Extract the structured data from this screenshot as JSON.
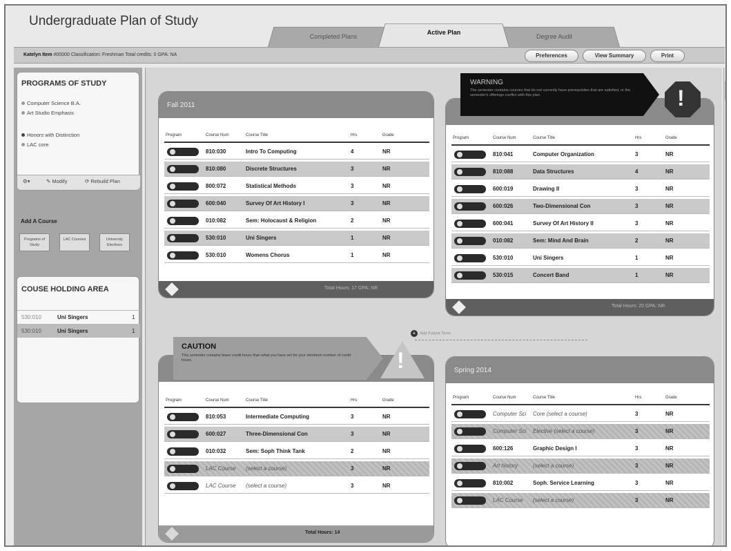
{
  "app_title": "Undergraduate Plan of Study",
  "tabs": [
    {
      "label": "Completed Plans"
    },
    {
      "label": "Active Plan",
      "active": true
    },
    {
      "label": "Degree Audit"
    }
  ],
  "student": {
    "name": "Katelyn Item",
    "id": "#00000",
    "info": "Classification: Freshman   Total credits: 0   GPA: NA"
  },
  "header_buttons": [
    "Preferences",
    "View Summary",
    "Print"
  ],
  "sidebar": {
    "programs_title": "PROGRAMS OF STUDY",
    "programs": [
      "Computer Science B.A.",
      "Art Studio Emphasis",
      "Honors with Distinction",
      "LAC core"
    ],
    "actions": {
      "modify": "Modify",
      "rebuild": "Rebuild Plan"
    },
    "add_course": {
      "title": "Add A Course",
      "buttons": [
        "Programs of Study",
        "LAC Courses",
        "University Electives"
      ]
    },
    "holding": {
      "title": "COUSE HOLDING AREA",
      "items": [
        {
          "num": "530:010",
          "title": "Uni Singers",
          "hrs": "1"
        },
        {
          "num": "530:010",
          "title": "Uni Singers",
          "hrs": "1"
        }
      ]
    }
  },
  "columns": [
    "Program",
    "Course Num",
    "Course Title",
    "Hrs",
    "Grade"
  ],
  "semesters": {
    "fall2011": {
      "title": "Fall 2011",
      "rows": [
        {
          "num": "810:030",
          "title": "Intro To Computing",
          "hrs": "4",
          "grade": "NR"
        },
        {
          "num": "810:080",
          "title": "Discrete Structures",
          "hrs": "3",
          "grade": "NR"
        },
        {
          "num": "800:072",
          "title": "Statistical Methods",
          "hrs": "3",
          "grade": "NR"
        },
        {
          "num": "600:040",
          "title": "Survey Of Art History I",
          "hrs": "3",
          "grade": "NR"
        },
        {
          "num": "010:082",
          "title": "Sem: Holocaust & Religion",
          "hrs": "2",
          "grade": "NR"
        },
        {
          "num": "530:010",
          "title": "Uni Singers",
          "hrs": "1",
          "grade": "NR"
        },
        {
          "num": "530:010",
          "title": "Womens Chorus",
          "hrs": "1",
          "grade": "NR"
        }
      ],
      "footer": "Total Hours: 17   GPA: NR"
    },
    "spring2012": {
      "rows": [
        {
          "num": "810:041",
          "title": "Computer Organization",
          "hrs": "3",
          "grade": "NR"
        },
        {
          "num": "810:088",
          "title": "Data Structures",
          "hrs": "4",
          "grade": "NR"
        },
        {
          "num": "600:019",
          "title": "Drawing II",
          "hrs": "3",
          "grade": "NR"
        },
        {
          "num": "600:026",
          "title": "Two-Dimensional Con",
          "hrs": "3",
          "grade": "NR"
        },
        {
          "num": "600:041",
          "title": "Survey Of Art History II",
          "hrs": "3",
          "grade": "NR"
        },
        {
          "num": "010:082",
          "title": "Sem: Mind And Brain",
          "hrs": "2",
          "grade": "NR"
        },
        {
          "num": "530:010",
          "title": "Uni Singers",
          "hrs": "1",
          "grade": "NR"
        },
        {
          "num": "530:015",
          "title": "Concert Band",
          "hrs": "1",
          "grade": "NR"
        }
      ],
      "footer": "Total Hours: 20   GPA: NR"
    },
    "fall2013": {
      "rows": [
        {
          "num": "810:053",
          "title": "Intermediate Computing",
          "hrs": "3",
          "grade": "NR"
        },
        {
          "num": "600:027",
          "title": "Three-Dimensional Con",
          "hrs": "3",
          "grade": "NR"
        },
        {
          "num": "010:032",
          "title": "Sem: Soph Think Tank",
          "hrs": "2",
          "grade": "NR"
        },
        {
          "num": "LAC Course",
          "title": "(select a course)",
          "hrs": "3",
          "grade": "NR"
        },
        {
          "num": "LAC Course",
          "title": "(select a course)",
          "hrs": "3",
          "grade": "NR"
        }
      ],
      "footer": "Total Hours: 14"
    },
    "spring2014": {
      "title": "Spring 2014",
      "rows": [
        {
          "num": "Computer Sci",
          "title": "Core (select a course)",
          "hrs": "3",
          "grade": "NR"
        },
        {
          "num": "Computer Sci",
          "title": "Elective (select a course)",
          "hrs": "3",
          "grade": "NR"
        },
        {
          "num": "600:126",
          "title": "Graphic Design I",
          "hrs": "3",
          "grade": "NR"
        },
        {
          "num": "Art history",
          "title": "(select a course)",
          "hrs": "3",
          "grade": "NR"
        },
        {
          "num": "810:002",
          "title": "Soph. Service Learning",
          "hrs": "3",
          "grade": "NR"
        },
        {
          "num": "LAC Course",
          "title": "(select a course)",
          "hrs": "3",
          "grade": "NR"
        }
      ]
    }
  },
  "warning": {
    "title": "WARNING",
    "text": "The semester contains courses that do not currently have prerequisites that are satisfied, or the semester's offerings conflict with this plan."
  },
  "caution": {
    "title": "CAUTION",
    "text": "This semester contains fewer credit hours than what you have set for your minimum number of credit hours."
  },
  "add_future_term": "Add Future Term"
}
